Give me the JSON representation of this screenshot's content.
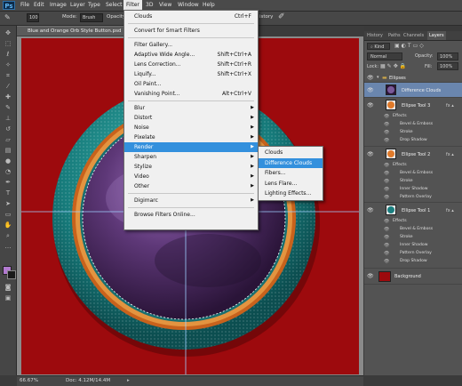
{
  "menubar": {
    "logo": "Ps",
    "items": [
      "File",
      "Edit",
      "Image",
      "Layer",
      "Type",
      "Select",
      "Filter",
      "3D",
      "View",
      "Window",
      "Help"
    ]
  },
  "options": {
    "size_value": "100",
    "mode_label": "Mode:",
    "mode_value": "Brush",
    "opacity_label": "Opacity",
    "history_label": "istory"
  },
  "document": {
    "tab_title": "Blue and Orange Orb Style Button.psd",
    "zoom": "66.67%",
    "doc_info": "Doc: 4.12M/14.4M"
  },
  "filter_menu": {
    "items": [
      {
        "label": "Clouds",
        "shortcut": "Ctrl+F",
        "sub": false
      },
      {
        "sep": true
      },
      {
        "label": "Convert for Smart Filters",
        "shortcut": "",
        "sub": false
      },
      {
        "sep": true
      },
      {
        "label": "Filter Gallery...",
        "shortcut": "",
        "sub": false
      },
      {
        "label": "Adaptive Wide Angle...",
        "shortcut": "Shift+Ctrl+A",
        "sub": false
      },
      {
        "label": "Lens Correction...",
        "shortcut": "Shift+Ctrl+R",
        "sub": false
      },
      {
        "label": "Liquify...",
        "shortcut": "Shift+Ctrl+X",
        "sub": false
      },
      {
        "label": "Oil Paint...",
        "shortcut": "",
        "sub": false
      },
      {
        "label": "Vanishing Point...",
        "shortcut": "Alt+Ctrl+V",
        "sub": false
      },
      {
        "sep": true
      },
      {
        "label": "Blur",
        "shortcut": "",
        "sub": true
      },
      {
        "label": "Distort",
        "shortcut": "",
        "sub": true
      },
      {
        "label": "Noise",
        "shortcut": "",
        "sub": true
      },
      {
        "label": "Pixelate",
        "shortcut": "",
        "sub": true
      },
      {
        "label": "Render",
        "shortcut": "",
        "sub": true,
        "highlighted": true
      },
      {
        "label": "Sharpen",
        "shortcut": "",
        "sub": true
      },
      {
        "label": "Stylize",
        "shortcut": "",
        "sub": true
      },
      {
        "label": "Video",
        "shortcut": "",
        "sub": true
      },
      {
        "label": "Other",
        "shortcut": "",
        "sub": true
      },
      {
        "sep": true
      },
      {
        "label": "Digimarc",
        "shortcut": "",
        "sub": true
      },
      {
        "sep": true
      },
      {
        "label": "Browse Filters Online...",
        "shortcut": "",
        "sub": false
      }
    ]
  },
  "render_menu": {
    "items": [
      {
        "label": "Clouds"
      },
      {
        "label": "Difference Clouds",
        "highlighted": true
      },
      {
        "label": "Fibers..."
      },
      {
        "label": "Lens Flare..."
      },
      {
        "label": "Lighting Effects..."
      }
    ]
  },
  "panels": {
    "tabs": [
      "History",
      "Paths",
      "Channels",
      "Layers"
    ],
    "kind_filter": "Kind",
    "blend_mode": "Normal",
    "opacity_label": "Opacity:",
    "opacity_value": "100%",
    "lock_label": "Lock:",
    "fill_label": "Fill:",
    "fill_value": "100%",
    "group_name": "Ellipses",
    "layers": [
      {
        "name": "Difference Clouds",
        "effects": []
      },
      {
        "name": "Ellipse Tool 3",
        "effects": [
          "Effects",
          "Bevel & Emboss",
          "Stroke",
          "Drop Shadow"
        ]
      },
      {
        "name": "Ellipse Tool 2",
        "effects": [
          "Effects",
          "Bevel & Emboss",
          "Stroke",
          "Inner Shadow",
          "Pattern Overlay"
        ]
      },
      {
        "name": "Ellipse Tool 1",
        "effects": [
          "Effects",
          "Bevel & Emboss",
          "Stroke",
          "Inner Shadow",
          "Pattern Overlay",
          "Drop Shadow"
        ]
      },
      {
        "name": "Background",
        "effects": []
      }
    ]
  },
  "colors": {
    "canvas_red": "#9d0a0d",
    "highlight": "#3390dd",
    "teal": "#1a7f80",
    "orange": "#e07a2a",
    "purple": "#6b3f86"
  }
}
